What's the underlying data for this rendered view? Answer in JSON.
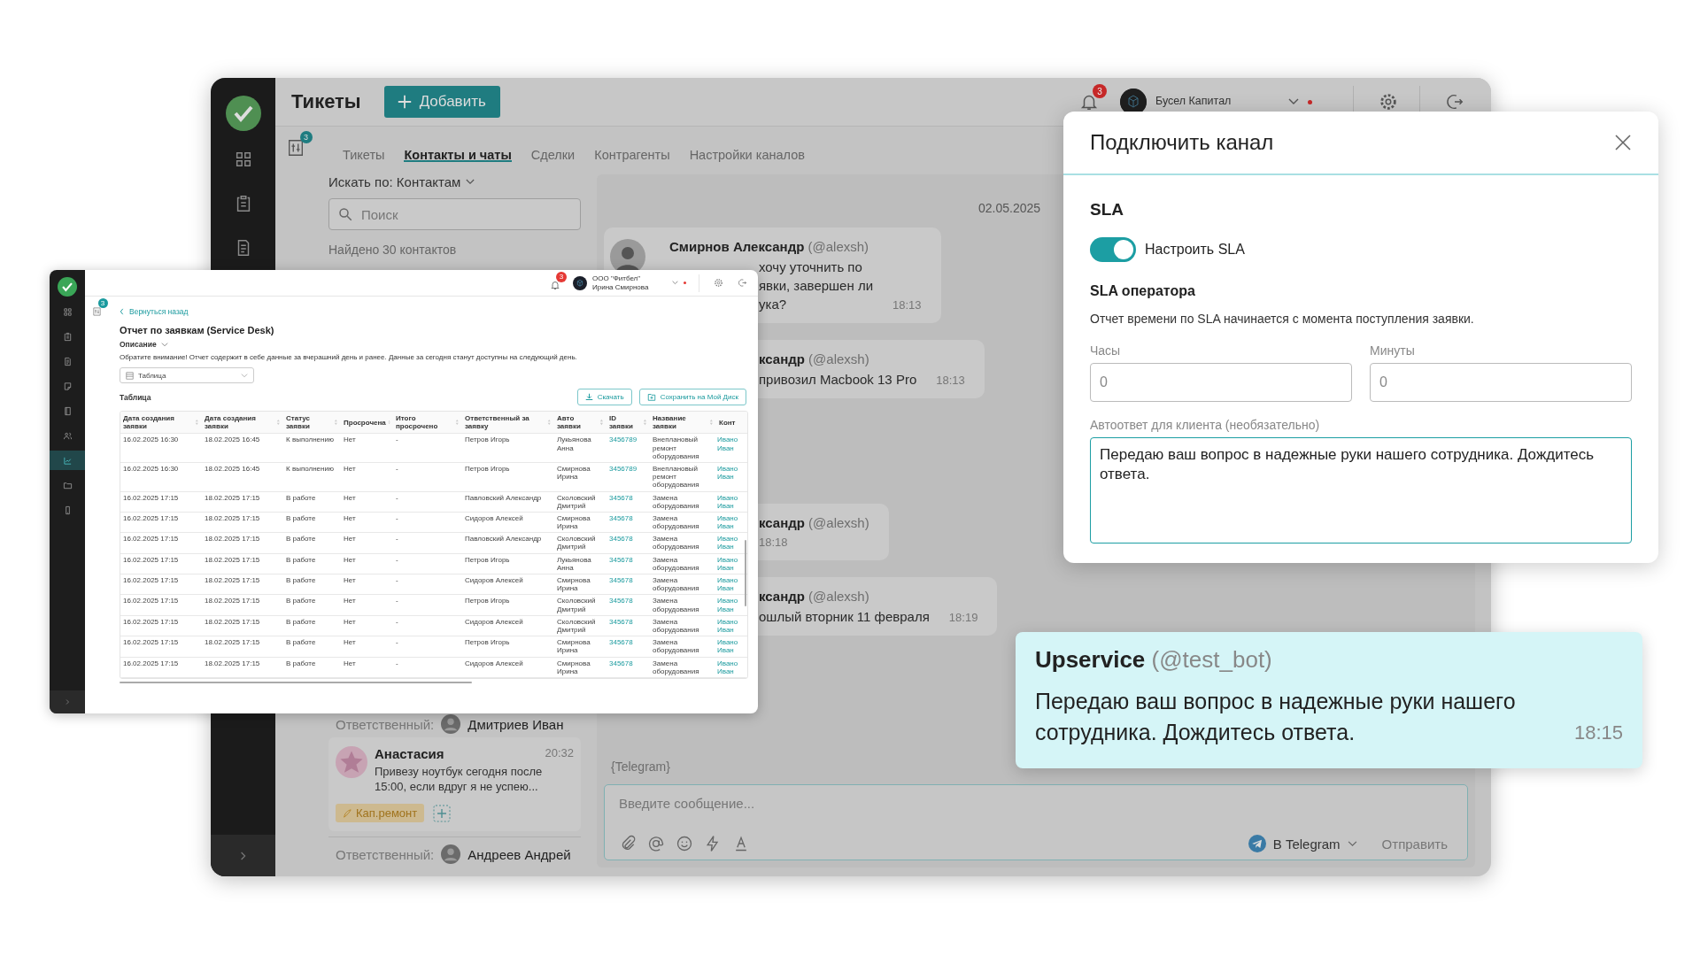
{
  "main_window": {
    "title": "Тикеты",
    "add_button": "Добавить",
    "notifications_badge": "3",
    "user": {
      "company": "Бусел Капитал"
    },
    "filter_badge": "3",
    "tabs": [
      {
        "label": "Тикеты",
        "selected": false
      },
      {
        "label": "Контакты и чаты",
        "selected": true
      },
      {
        "label": "Сделки",
        "selected": false
      },
      {
        "label": "Контрагенты",
        "selected": false
      },
      {
        "label": "Настройки каналов",
        "selected": false
      }
    ],
    "search_by": "Искать по: Контактам",
    "search": {
      "placeholder": "Поиск"
    },
    "found": "Найдено 30 контактов",
    "responsible_top": {
      "label": "Ответственный:",
      "name": "Дмитриев Иван"
    },
    "contact_card": {
      "name": "Анастасия",
      "time": "20:32",
      "preview": "Привезу ноутбук сегодня после 15:00, если вдруг я не успею...",
      "tag": "Кап.ремонт",
      "responsible": {
        "label": "Ответственный:",
        "name": "Андреев Андрей"
      }
    },
    "chat": {
      "date": "02.05.2025",
      "messages": [
        {
          "author": "Смирнов Александр",
          "handle": "(@alexsh)",
          "lines": [
            "хочу уточнить по",
            "явки, завершен ли",
            "ука?"
          ],
          "time": "18:13"
        },
        {
          "author": "ксандр",
          "handle": "(@alexsh)",
          "lines": [
            "привозил Macbook 13 Pro"
          ],
          "time": "18:13"
        },
        {
          "author": "ксандр",
          "handle": "(@alexsh)",
          "time": "18:18"
        },
        {
          "author": "ксандр",
          "handle": "(@alexsh)",
          "lines": [
            "ошлый вторник 11 февраля"
          ],
          "time": "18:19"
        }
      ],
      "channel_note": "{Telegram}"
    },
    "composer": {
      "placeholder": "Введите сообщение...",
      "channel": "В Telegram",
      "send": "Отправить"
    }
  },
  "report_window": {
    "notifications_badge": "3",
    "user": {
      "company": "ООО \"Фитбел\"",
      "name": "Ирина Смирнова"
    },
    "filter_badge": "3",
    "nav": [
      {
        "selected": false
      },
      {
        "selected": false
      },
      {
        "selected": false
      },
      {
        "selected": false
      },
      {
        "selected": false
      },
      {
        "selected": false
      },
      {
        "selected": true
      },
      {
        "selected": false
      },
      {
        "selected": false
      }
    ],
    "back": "Вернуться назад",
    "title": "Отчет по заявкам (Service Desk)",
    "description_toggle": "Описание",
    "notice": "Обратите внимание! Отчет содержит в себе данные за вчерашний день и ранее. Данные за сегодня станут доступны на следующий день.",
    "view_select": "Таблица",
    "section_title": "Таблица",
    "download_button": "Скачать",
    "save_button": "Сохранить на Мой Диск",
    "table": {
      "columns": [
        "Дата создания заявки",
        "Дата создания заявки",
        "Статус заявки",
        "Просрочена",
        "Итого просрочено",
        "Ответственный за заявку",
        "Авто заявки",
        "ID заявки",
        "Название заявки",
        "Конт"
      ],
      "rows": [
        {
          "cells": [
            "16.02.2025 16:30",
            "18.02.2025 16:45",
            "К выполнению",
            "Нет",
            "-",
            "Петров Игорь",
            "Лукьянова Анна",
            "3456789",
            "Внеплановый ремонт оборудования",
            "Ивано Иван"
          ]
        },
        {
          "cells": [
            "16.02.2025 16:30",
            "18.02.2025 16:45",
            "К выполнению",
            "Нет",
            "-",
            "Петров Игорь",
            "Смирнова Ирина",
            "3456789",
            "Внеплановый ремонт оборудования",
            "Ивано Иван"
          ]
        },
        {
          "cells": [
            "16.02.2025 17:15",
            "18.02.2025 17:15",
            "В работе",
            "Нет",
            "-",
            "Павловский Александр",
            "Сколовский Дмитрий",
            "345678",
            "Замена оборудования",
            "Ивано Иван"
          ]
        },
        {
          "cells": [
            "16.02.2025 17:15",
            "18.02.2025 17:15",
            "В работе",
            "Нет",
            "-",
            "Сидоров Алексей",
            "Смирнова Ирина",
            "345678",
            "Замена оборудования",
            "Ивано Иван"
          ]
        },
        {
          "cells": [
            "16.02.2025 17:15",
            "18.02.2025 17:15",
            "В работе",
            "Нет",
            "-",
            "Павловский Александр",
            "Сколовский Дмитрий",
            "345678",
            "Замена оборудования",
            "Ивано Иван"
          ]
        },
        {
          "cells": [
            "16.02.2025 17:15",
            "18.02.2025 17:15",
            "В работе",
            "Нет",
            "-",
            "Петров Игорь",
            "Лукьянова Анна",
            "345678",
            "Замена оборудования",
            "Ивано Иван"
          ]
        },
        {
          "cells": [
            "16.02.2025 17:15",
            "18.02.2025 17:15",
            "В работе",
            "Нет",
            "-",
            "Сидоров Алексей",
            "Смирнова Ирина",
            "345678",
            "Замена оборудования",
            "Ивано Иван"
          ]
        },
        {
          "cells": [
            "16.02.2025 17:15",
            "18.02.2025 17:15",
            "В работе",
            "Нет",
            "-",
            "Петров Игорь",
            "Сколовский Дмитрий",
            "345678",
            "Замена оборудования",
            "Ивано Иван"
          ]
        },
        {
          "cells": [
            "16.02.2025 17:15",
            "18.02.2025 17:15",
            "В работе",
            "Нет",
            "-",
            "Сидоров Алексей",
            "Сколовский Дмитрий",
            "345678",
            "Замена оборудования",
            "Ивано Иван"
          ]
        },
        {
          "cells": [
            "16.02.2025 17:15",
            "18.02.2025 17:15",
            "В работе",
            "Нет",
            "-",
            "Петров Игорь",
            "Смирнова Ирина",
            "345678",
            "Замена оборудования",
            "Ивано Иван"
          ]
        },
        {
          "cells": [
            "16.02.2025 17:15",
            "18.02.2025 17:15",
            "В работе",
            "Нет",
            "-",
            "Сидоров Алексей",
            "Смирнова Ирина",
            "345678",
            "Замена оборудования",
            "Ивано Иван"
          ]
        }
      ]
    }
  },
  "dialog": {
    "title": "Подключить канал",
    "section": "SLA",
    "sla_toggle": {
      "label": "Настроить SLA",
      "on": true
    },
    "operator_title": "SLA оператора",
    "operator_note": "Отчет времени по SLA начинается с момента поступления заявки.",
    "hours": {
      "label": "Часы",
      "placeholder": "0"
    },
    "minutes": {
      "label": "Минуты",
      "placeholder": "0"
    },
    "autoreply": {
      "label": "Автоответ для клиента (необязательно)",
      "value": "Передаю ваш вопрос в надежные руки нашего сотрудника. Дождитесь ответа."
    }
  },
  "bot_message": {
    "author": "Upservice",
    "handle": "(@test_bot)",
    "text": "Передаю ваш вопрос в надежные руки нашего сотрудника. Дождитесь ответа.",
    "time": "18:15"
  }
}
